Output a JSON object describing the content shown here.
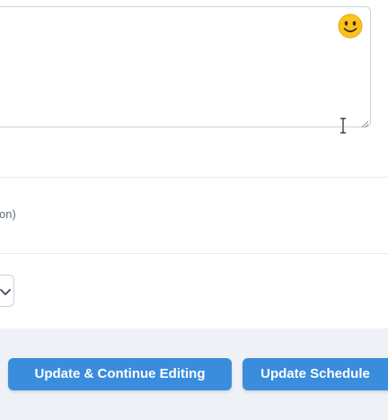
{
  "form": {
    "textarea": {
      "value": "",
      "emoji_icon": "smiley-face-icon"
    },
    "option_hint": "on)",
    "select": {
      "selected": ""
    }
  },
  "footer": {
    "continue_label": "Update & Continue Editing",
    "update_label": "Update Schedule"
  },
  "colors": {
    "primary": "#3a8ddd",
    "footer_bg": "#eef1f6",
    "border": "#c9d1db"
  }
}
